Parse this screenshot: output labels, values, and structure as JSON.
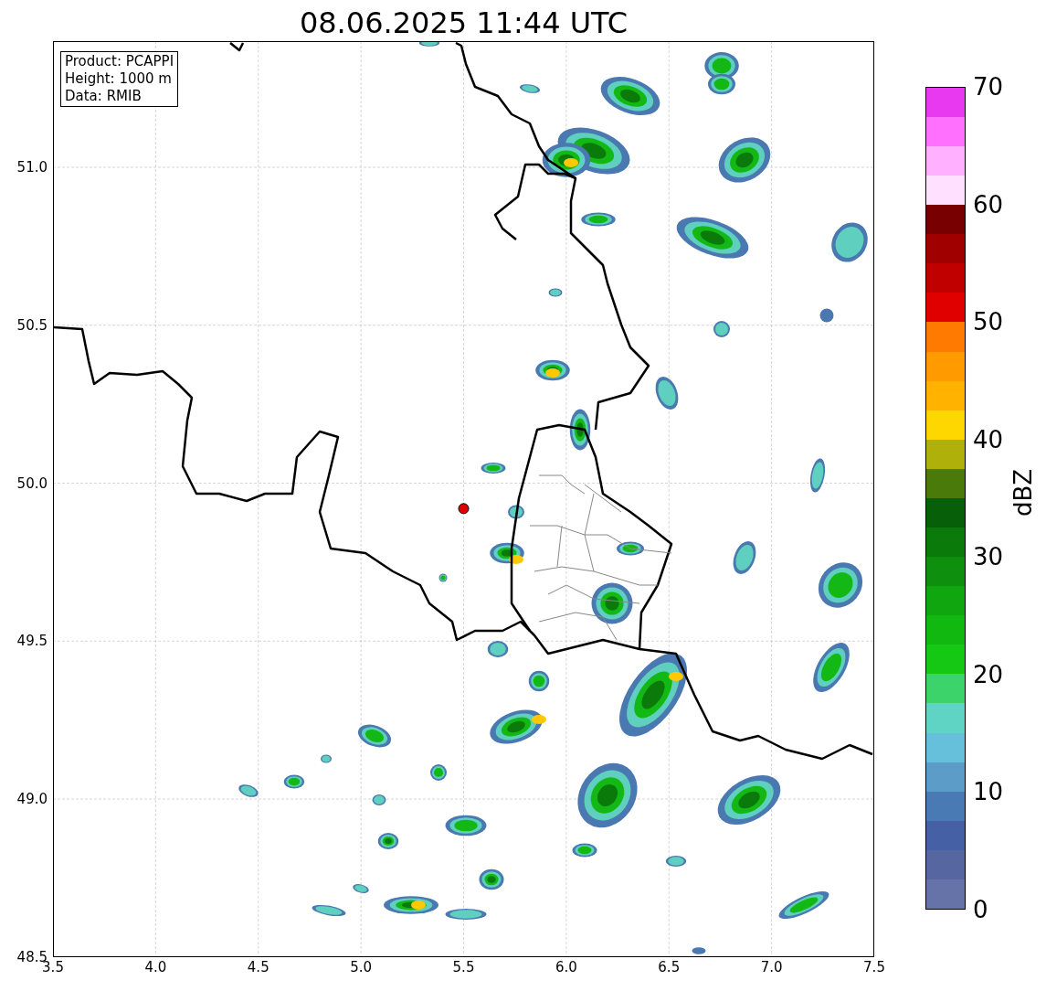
{
  "title": "08.06.2025 11:44 UTC",
  "info_box": [
    "Product: PCAPPI",
    "Height: 1000 m",
    "Data: RMIB"
  ],
  "map": {
    "xticks": [
      "3.5",
      "4.0",
      "4.5",
      "5.0",
      "5.5",
      "6.0",
      "6.5",
      "7.0",
      "7.5"
    ],
    "yticks": [
      "51.0",
      "50.5",
      "50.0",
      "49.5",
      "49.0",
      "48.5"
    ]
  },
  "colorbar": {
    "label": "dBZ",
    "ticks": [
      "70",
      "60",
      "50",
      "40",
      "30",
      "20",
      "10",
      "0"
    ],
    "bands": [
      {
        "color": "#6673a8"
      },
      {
        "color": "#5666a0"
      },
      {
        "color": "#4560a5"
      },
      {
        "color": "#4a7ab4"
      },
      {
        "color": "#5b9cc8"
      },
      {
        "color": "#66c0dc"
      },
      {
        "color": "#5fd4c4"
      },
      {
        "color": "#3cd46a"
      },
      {
        "color": "#14c814"
      },
      {
        "color": "#10b810"
      },
      {
        "color": "#0fa60f"
      },
      {
        "color": "#0e900e"
      },
      {
        "color": "#0a7a0a"
      },
      {
        "color": "#085f0a"
      },
      {
        "color": "#4a7a0a"
      },
      {
        "color": "#b0b00a"
      },
      {
        "color": "#ffd700"
      },
      {
        "color": "#ffb300"
      },
      {
        "color": "#ff9a00"
      },
      {
        "color": "#ff7a00"
      },
      {
        "color": "#e00000"
      },
      {
        "color": "#c00000"
      },
      {
        "color": "#a00000"
      },
      {
        "color": "#780000"
      },
      {
        "color": "#ffe0ff"
      },
      {
        "color": "#ffb0ff"
      },
      {
        "color": "#ff70ff"
      },
      {
        "color": "#e838f0"
      }
    ]
  }
}
